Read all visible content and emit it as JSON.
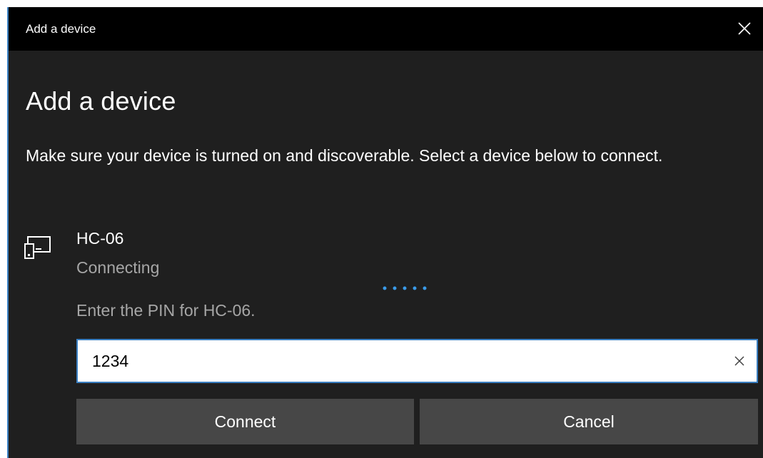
{
  "window": {
    "title": "Add a device"
  },
  "main": {
    "heading": "Add a device",
    "instructions": "Make sure your device is turned on and discoverable. Select a device below to connect."
  },
  "device": {
    "icon": "devices-icon",
    "name": "HC-06",
    "status": "Connecting",
    "pin_prompt": "Enter the PIN for HC-06.",
    "pin_value": "1234"
  },
  "buttons": {
    "connect_label": "Connect",
    "cancel_label": "Cancel"
  },
  "colors": {
    "window_bg": "#1f1f1f",
    "titlebar_bg": "#000000",
    "accent": "#3a7fc1",
    "button_bg": "#474747",
    "secondary_text": "#a6a6a6"
  }
}
